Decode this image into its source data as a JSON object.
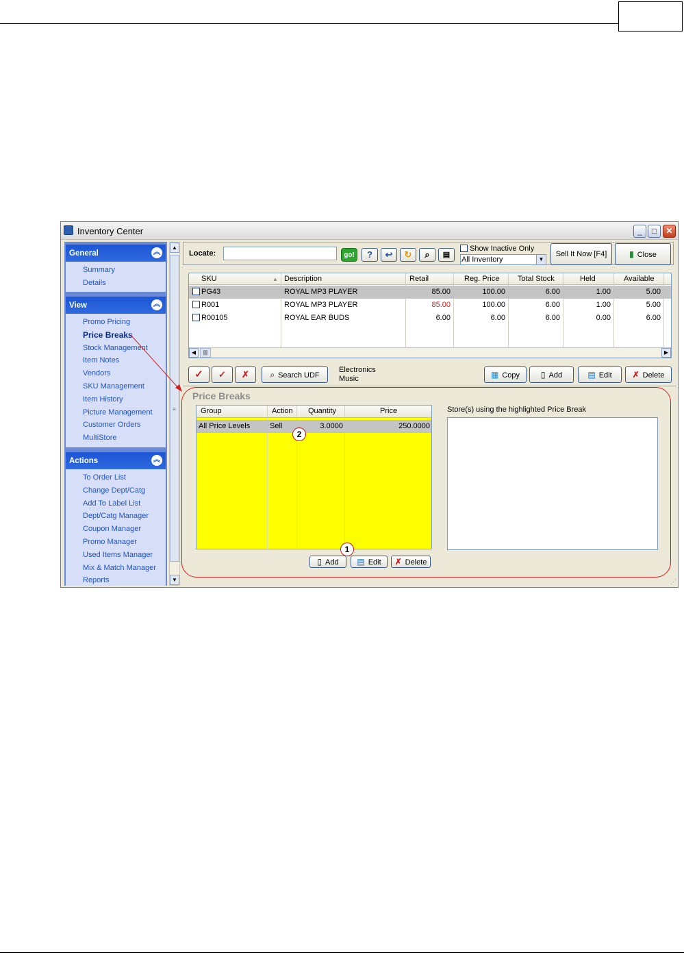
{
  "window": {
    "title": "Inventory Center"
  },
  "nav": {
    "groups": [
      {
        "title": "General",
        "items": [
          {
            "label": "Summary"
          },
          {
            "label": "Details"
          }
        ]
      },
      {
        "title": "View",
        "items": [
          {
            "label": "Promo Pricing"
          },
          {
            "label": "Price Breaks"
          },
          {
            "label": "Stock Management"
          },
          {
            "label": "Item Notes"
          },
          {
            "label": "Vendors"
          },
          {
            "label": "SKU Management"
          },
          {
            "label": "Item History"
          },
          {
            "label": "Picture Management"
          },
          {
            "label": "Customer Orders"
          },
          {
            "label": "MultiStore"
          }
        ]
      },
      {
        "title": "Actions",
        "items": [
          {
            "label": "To Order List"
          },
          {
            "label": "Change Dept/Catg"
          },
          {
            "label": "Add To Label List"
          },
          {
            "label": "Dept/Catg Manager"
          },
          {
            "label": "Coupon Manager"
          },
          {
            "label": "Promo Manager"
          },
          {
            "label": "Used Items Manager"
          },
          {
            "label": "Mix & Match Manager"
          },
          {
            "label": "Reports"
          }
        ]
      }
    ],
    "active_item": "Price Breaks"
  },
  "toolbar": {
    "locate_label": "Locate:",
    "locate_value": "",
    "go_label": "go!",
    "show_inactive_label": "Show Inactive Only",
    "inventory_filter": "All Inventory",
    "sell_now_label": "Sell It Now [F4]",
    "close_label": "Close"
  },
  "grid": {
    "columns": [
      "SKU",
      "Description",
      "Retail",
      "Reg. Price",
      "Total Stock",
      "Held",
      "Available"
    ],
    "rows": [
      {
        "sku": "PG43",
        "description": "ROYAL MP3 PLAYER",
        "retail": "85.00",
        "reg_price": "100.00",
        "total_stock": "6.00",
        "held": "1.00",
        "available": "5.00"
      },
      {
        "sku": "R001",
        "description": "ROYAL MP3 PLAYER",
        "retail": "85.00",
        "reg_price": "100.00",
        "total_stock": "6.00",
        "held": "1.00",
        "available": "5.00"
      },
      {
        "sku": "R00105",
        "description": "ROYAL EAR BUDS",
        "retail": "6.00",
        "reg_price": "6.00",
        "total_stock": "6.00",
        "held": "0.00",
        "available": "6.00"
      }
    ],
    "selected_row": 0
  },
  "actions": {
    "search_ude_label": "Search UDF",
    "dept": "Electronics",
    "category": "Music",
    "copy_label": "Copy",
    "add_label": "Add",
    "edit_label": "Edit",
    "delete_label": "Delete"
  },
  "price_breaks": {
    "title": "Price Breaks",
    "columns": [
      "Group",
      "Action",
      "Quantity",
      "Price"
    ],
    "rows": [
      {
        "group": "All Price Levels",
        "action": "Sell",
        "quantity": "3.0000",
        "price": "250.0000"
      }
    ],
    "stores_label": "Store(s) using the highlighted Price Break",
    "add_label": "Add",
    "edit_label": "Edit",
    "delete_label": "Delete"
  },
  "callouts": {
    "one": "1",
    "two": "2"
  },
  "colors": {
    "accent": "#d21c1c",
    "grid_fill": "#ffff00",
    "nav_header": "#1c56d5",
    "red_value": "#d21c1c"
  }
}
